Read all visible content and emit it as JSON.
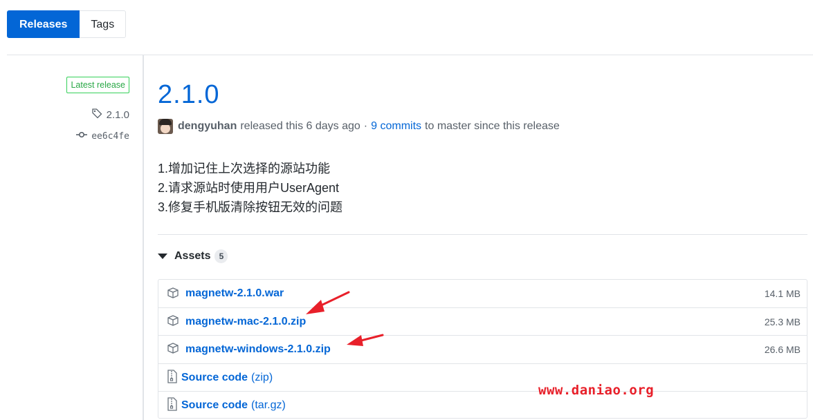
{
  "tabs": {
    "releases": "Releases",
    "tags": "Tags"
  },
  "sidebar": {
    "latest_badge": "Latest release",
    "tag": "2.1.0",
    "commit": "ee6c4fe"
  },
  "release": {
    "title": "2.1.0",
    "author": "dengyuhan",
    "released_text": "released this 6 days ago",
    "separator": "·",
    "commits_link": "9 commits",
    "commits_suffix": "to master since this release",
    "notes": [
      "1.增加记住上次选择的源站功能",
      "2.请求源站时使用用户UserAgent",
      "3.修复手机版清除按钮无效的问题"
    ]
  },
  "assets": {
    "heading": "Assets",
    "count": "5",
    "files": [
      {
        "name": "magnetw-2.1.0.war",
        "size": "14.1 MB",
        "icon": "package-icon"
      },
      {
        "name": "magnetw-mac-2.1.0.zip",
        "size": "25.3 MB",
        "icon": "package-icon"
      },
      {
        "name": "magnetw-windows-2.1.0.zip",
        "size": "26.6 MB",
        "icon": "package-icon"
      }
    ],
    "sources": [
      {
        "label": "Source code",
        "format": "(zip)",
        "icon": "file-zip-icon"
      },
      {
        "label": "Source code",
        "format": "(tar.gz)",
        "icon": "file-zip-icon"
      }
    ]
  },
  "watermark": "www.daniao.org",
  "colors": {
    "accent": "#0366d6",
    "latest_green": "#28a745",
    "annotation_red": "#e8202a"
  }
}
